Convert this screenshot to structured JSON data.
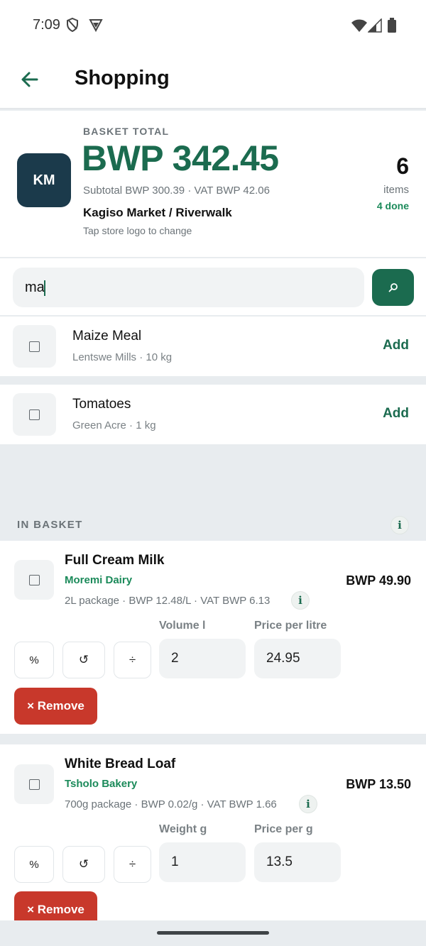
{
  "status_bar": {
    "time": "7:09"
  },
  "app_bar": {
    "title": "Shopping"
  },
  "summary": {
    "label": "BASKET TOTAL",
    "total": "BWP 342.45",
    "subtotal": "Subtotal BWP 300.39 · VAT BWP 42.06",
    "store_name": "Kagiso Market / Riverwalk",
    "store_hint": "Tap store logo to change",
    "store_initials": "KM",
    "item_count": "6",
    "items_label": "items",
    "done_label": "4 done"
  },
  "search": {
    "value": "ma",
    "button_icon": "⌕"
  },
  "suggestions": [
    {
      "name": "Maize Meal",
      "meta": "Lentswe Mills · 10 kg",
      "action": "Add"
    },
    {
      "name": "Tomatoes",
      "meta": "Green Acre · 1 kg",
      "action": "Add"
    }
  ],
  "basket": {
    "heading": "IN BASKET",
    "items": [
      {
        "name": "Full Cream Milk",
        "brand": "Moremi Dairy",
        "meta": "2L package · BWP 12.48/L · VAT BWP 6.13",
        "price": "BWP 49.90",
        "qty_label": "Volume l",
        "unit_price_label": "Price per litre",
        "qty_value": "2",
        "unit_price_value": "24.95",
        "remove_label": "× Remove"
      },
      {
        "name": "White Bread Loaf",
        "brand": "Tsholo Bakery",
        "meta": "700g package · BWP 0.02/g · VAT BWP 1.66",
        "price": "BWP 13.50",
        "qty_label": "Weight g",
        "unit_price_label": "Price per g",
        "qty_value": "1",
        "unit_price_value": "13.5",
        "remove_label": "× Remove"
      }
    ]
  },
  "tools": {
    "percent": "%",
    "reset": "↺",
    "divide": "÷",
    "info": "i"
  },
  "colors": {
    "accent": "#1b6b4f",
    "accent_light": "#1b8a5a",
    "danger": "#c8382b",
    "logo_bg": "#1b3a4b"
  }
}
